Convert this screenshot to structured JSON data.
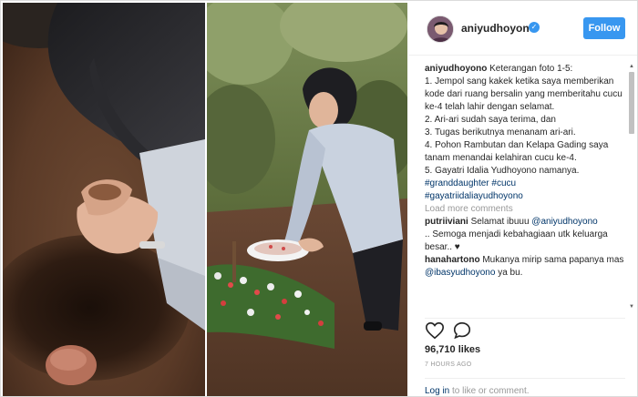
{
  "post": {
    "username": "aniyudhoyono",
    "verified_mark": "✓",
    "follow_label": "Follow",
    "caption_user": "aniyudhoyono",
    "caption_text": " Keterangan foto 1-5:\n1. Jempol sang kakek ketika saya memberikan kode dari ruang bersalin yang memberitahu cucu ke-4 telah lahir dengan selamat.\n2. Ari-ari sudah saya terima, dan\n3. Tugas berikutnya menanam ari-ari.\n4. Pohon Rambutan dan Kelapa Gading saya tanam menandai kelahiran cucu ke-4.\n5. Gayatri Idalia Yudhoyono namanya.",
    "hashtags": "#granddaughter #cucu\n#gayatriidaliayudhoyono",
    "load_more": "Load more comments",
    "comments": [
      {
        "user": "putriiviani",
        "text_before": " Selamat ibuuu ",
        "mention": "@aniyudhoyono",
        "text_after": "\n.. Semoga menjadi kebahagiaan utk keluarga besar.. ♥"
      },
      {
        "user": "hanahartono",
        "text_before": " Mukanya mirip sama papanya mas ",
        "mention": "@ibasyudhoyono",
        "text_after": " ya bu."
      }
    ],
    "likes": "96,710 likes",
    "time": "7 HOURS AGO",
    "login_link": "Log in",
    "login_rest": " to like or comment."
  },
  "icons": {
    "avatar": "avatar",
    "verified": "verified-badge-icon",
    "heart": "heart-icon",
    "comment": "comment-icon",
    "more": "more-icon"
  },
  "colors": {
    "accent": "#3897f0",
    "link": "#003569",
    "muted": "#999999",
    "text": "#262626"
  }
}
